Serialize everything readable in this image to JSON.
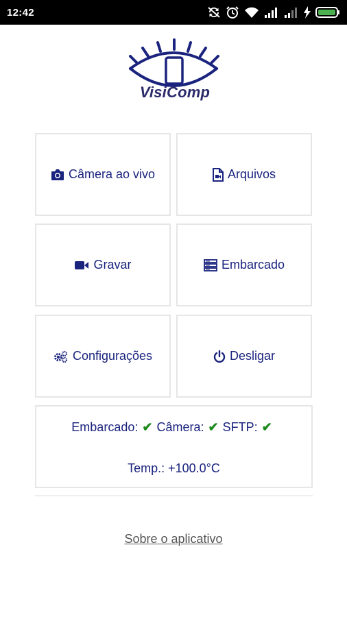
{
  "status_bar": {
    "time": "12:42",
    "icons": [
      "sync-off-icon",
      "alarm-icon",
      "wifi-icon",
      "signal-icon",
      "signal-weak-icon",
      "charging-icon",
      "battery-icon"
    ],
    "battery_color": "#4caf50"
  },
  "logo": {
    "text": "VisiComp",
    "icon": "eye-logo-icon",
    "color": "#1a237e"
  },
  "menu": {
    "live_camera": {
      "label": "Câmera ao vivo",
      "icon": "camera-icon"
    },
    "files": {
      "label": "Arquivos",
      "icon": "file-video-icon"
    },
    "record": {
      "label": "Gravar",
      "icon": "video-camera-icon"
    },
    "embedded": {
      "label": "Embarcado",
      "icon": "server-icon"
    },
    "settings": {
      "label": "Configurações",
      "icon": "gears-icon"
    },
    "shutdown": {
      "label": "Desligar",
      "icon": "power-icon"
    }
  },
  "status": {
    "embedded_label": "Embarcado:",
    "camera_label": "Câmera:",
    "sftp_label": "SFTP:",
    "check": "✔",
    "temp": "Temp.: +100.0°C",
    "check_color": "#1e8a1e"
  },
  "footer": {
    "about_label": "Sobre o aplicativo"
  },
  "colors": {
    "accent": "#1a237e",
    "tile_border": "#e6e6e6"
  }
}
